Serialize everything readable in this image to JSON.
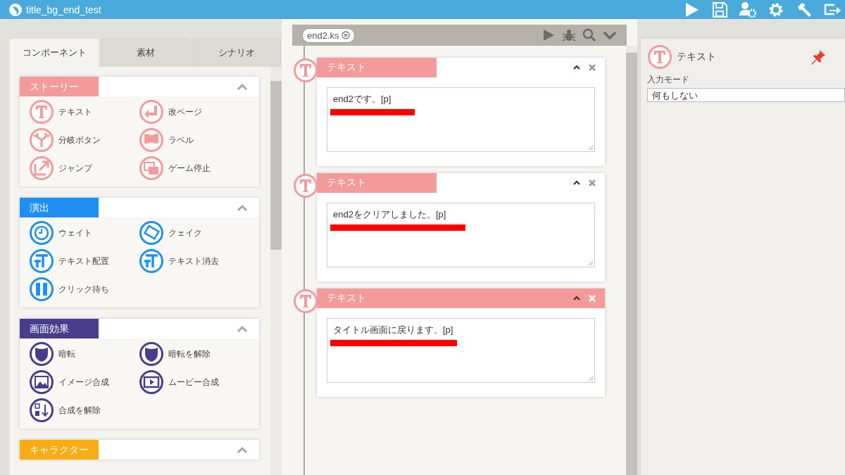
{
  "window": {
    "title": "title_bg_end_test"
  },
  "left_tabs": [
    {
      "label": "コンポーネント",
      "selected": true
    },
    {
      "label": "素材",
      "selected": false
    },
    {
      "label": "シナリオ",
      "selected": false
    }
  ],
  "sections": [
    {
      "title": "ストーリー",
      "color": "#f59a9a",
      "expanded": true,
      "items": [
        "テキスト",
        "改ページ",
        "分岐ボタン",
        "ラベル",
        "ジャンプ",
        "ゲーム停止"
      ]
    },
    {
      "title": "演出",
      "color": "#1e90f5",
      "expanded": true,
      "items": [
        "ウェイト",
        "クェイク",
        "テキスト配置",
        "テキスト消去",
        "クリック待ち"
      ]
    },
    {
      "title": "画面効果",
      "color": "#483c8c",
      "expanded": true,
      "items": [
        "暗転",
        "暗転を解除",
        "イメージ合成",
        "ムービー合成",
        "合成を解除"
      ]
    },
    {
      "title": "キャラクター",
      "color": "#f8ad14",
      "expanded": true
    }
  ],
  "file_tab": {
    "label": "end2.ks"
  },
  "blocks": [
    {
      "title": "テキスト",
      "selected": false,
      "value": "end2です。[p]"
    },
    {
      "title": "テキスト",
      "selected": false,
      "value": "end2をクリアしました。[p]"
    },
    {
      "title": "テキスト",
      "selected": true,
      "value": "タイトル画面に戻ります。[p]"
    }
  ],
  "inspector": {
    "title": "テキスト",
    "field_label": "入力モード",
    "field_value": "何もしない"
  }
}
